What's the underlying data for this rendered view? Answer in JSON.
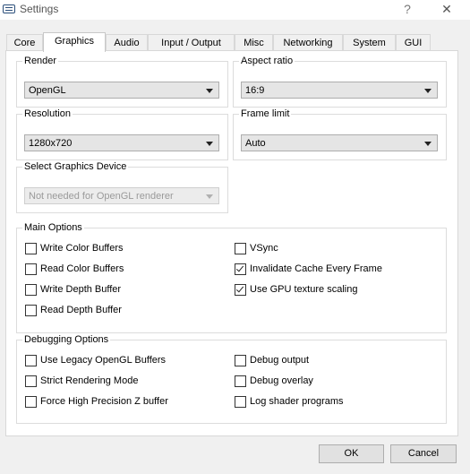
{
  "window": {
    "title": "Settings",
    "help": "?",
    "close": "✕"
  },
  "tabs": [
    "Core",
    "Graphics",
    "Audio",
    "Input / Output",
    "Misc",
    "Networking",
    "System",
    "GUI"
  ],
  "render": {
    "title": "Render",
    "value": "OpenGL"
  },
  "aspect": {
    "title": "Aspect ratio",
    "value": "16:9"
  },
  "resolution": {
    "title": "Resolution",
    "value": "1280x720"
  },
  "frame_limit": {
    "title": "Frame limit",
    "value": "Auto"
  },
  "device": {
    "title": "Select Graphics Device",
    "value": "Not needed for OpenGL renderer"
  },
  "main_options": {
    "title": "Main Options",
    "items": [
      {
        "label": "Write Color Buffers",
        "checked": false
      },
      {
        "label": "Read Color Buffers",
        "checked": false
      },
      {
        "label": "Write Depth Buffer",
        "checked": false
      },
      {
        "label": "Read Depth Buffer",
        "checked": false
      },
      {
        "label": "VSync",
        "checked": false
      },
      {
        "label": "Invalidate Cache Every Frame",
        "checked": true
      },
      {
        "label": "Use GPU texture scaling",
        "checked": true
      }
    ]
  },
  "debug_options": {
    "title": "Debugging Options",
    "items": [
      {
        "label": "Use Legacy OpenGL Buffers",
        "checked": false
      },
      {
        "label": "Strict Rendering Mode",
        "checked": false
      },
      {
        "label": "Force High Precision Z buffer",
        "checked": false
      },
      {
        "label": "Debug output",
        "checked": false
      },
      {
        "label": "Debug overlay",
        "checked": false
      },
      {
        "label": "Log shader programs",
        "checked": false
      }
    ]
  },
  "buttons": {
    "ok": "OK",
    "cancel": "Cancel"
  }
}
